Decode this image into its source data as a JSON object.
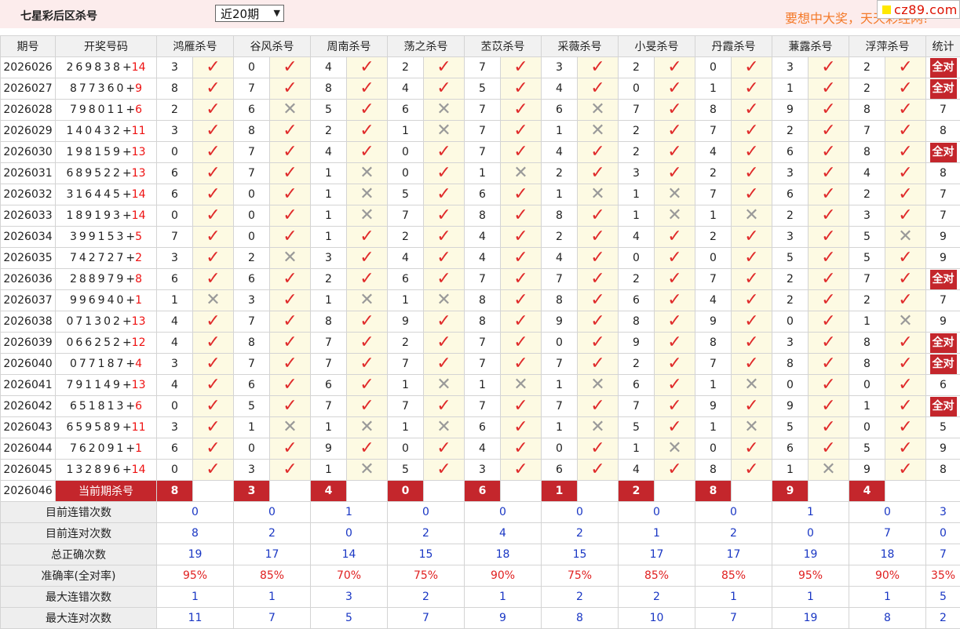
{
  "header": {
    "title": "七星彩后区杀号",
    "period_select": "近20期",
    "slogan": "要想中大奖，天天彩经网!",
    "badge": "cz89.com"
  },
  "columns": {
    "period": "期号",
    "draw": "开奖号码",
    "experts": [
      "鸿雁杀号",
      "谷风杀号",
      "周南杀号",
      "荡之杀号",
      "苤苡杀号",
      "采薇杀号",
      "小旻杀号",
      "丹霞杀号",
      "蒹露杀号",
      "浮萍杀号"
    ],
    "stats": "统计"
  },
  "rows": [
    {
      "period": "2026026",
      "front": "269838",
      "back": "14",
      "kills": [
        3,
        0,
        4,
        2,
        7,
        3,
        2,
        0,
        3,
        2
      ],
      "hits": [
        1,
        1,
        1,
        1,
        1,
        1,
        1,
        1,
        1,
        1
      ],
      "stat": "全对"
    },
    {
      "period": "2026027",
      "front": "877360",
      "back": "9",
      "kills": [
        8,
        7,
        8,
        4,
        5,
        4,
        0,
        1,
        1,
        2
      ],
      "hits": [
        1,
        1,
        1,
        1,
        1,
        1,
        1,
        1,
        1,
        1
      ],
      "stat": "全对"
    },
    {
      "period": "2026028",
      "front": "798011",
      "back": "6",
      "kills": [
        2,
        6,
        5,
        6,
        7,
        6,
        7,
        8,
        9,
        8
      ],
      "hits": [
        1,
        0,
        1,
        0,
        1,
        0,
        1,
        1,
        1,
        1
      ],
      "stat": "7"
    },
    {
      "period": "2026029",
      "front": "140432",
      "back": "11",
      "kills": [
        3,
        8,
        2,
        1,
        7,
        1,
        2,
        7,
        2,
        7
      ],
      "hits": [
        1,
        1,
        1,
        0,
        1,
        0,
        1,
        1,
        1,
        1
      ],
      "stat": "8"
    },
    {
      "period": "2026030",
      "front": "198159",
      "back": "13",
      "kills": [
        0,
        7,
        4,
        0,
        7,
        4,
        2,
        4,
        6,
        8
      ],
      "hits": [
        1,
        1,
        1,
        1,
        1,
        1,
        1,
        1,
        1,
        1
      ],
      "stat": "全对"
    },
    {
      "period": "2026031",
      "front": "689522",
      "back": "13",
      "kills": [
        6,
        7,
        1,
        0,
        1,
        2,
        3,
        2,
        3,
        4
      ],
      "hits": [
        1,
        1,
        0,
        1,
        0,
        1,
        1,
        1,
        1,
        1
      ],
      "stat": "8"
    },
    {
      "period": "2026032",
      "front": "316445",
      "back": "14",
      "kills": [
        6,
        0,
        1,
        5,
        6,
        1,
        1,
        7,
        6,
        2
      ],
      "hits": [
        1,
        1,
        0,
        1,
        1,
        0,
        0,
        1,
        1,
        1
      ],
      "stat": "7"
    },
    {
      "period": "2026033",
      "front": "189193",
      "back": "14",
      "kills": [
        0,
        0,
        1,
        7,
        8,
        8,
        1,
        1,
        2,
        3
      ],
      "hits": [
        1,
        1,
        0,
        1,
        1,
        1,
        0,
        0,
        1,
        1
      ],
      "stat": "7"
    },
    {
      "period": "2026034",
      "front": "399153",
      "back": "5",
      "kills": [
        7,
        0,
        1,
        2,
        4,
        2,
        4,
        2,
        3,
        5
      ],
      "hits": [
        1,
        1,
        1,
        1,
        1,
        1,
        1,
        1,
        1,
        0
      ],
      "stat": "9"
    },
    {
      "period": "2026035",
      "front": "742727",
      "back": "2",
      "kills": [
        3,
        2,
        3,
        4,
        4,
        4,
        0,
        0,
        5,
        5
      ],
      "hits": [
        1,
        0,
        1,
        1,
        1,
        1,
        1,
        1,
        1,
        1
      ],
      "stat": "9"
    },
    {
      "period": "2026036",
      "front": "288979",
      "back": "8",
      "kills": [
        6,
        6,
        2,
        6,
        7,
        7,
        2,
        7,
        2,
        7
      ],
      "hits": [
        1,
        1,
        1,
        1,
        1,
        1,
        1,
        1,
        1,
        1
      ],
      "stat": "全对"
    },
    {
      "period": "2026037",
      "front": "996940",
      "back": "1",
      "kills": [
        1,
        3,
        1,
        1,
        8,
        8,
        6,
        4,
        2,
        2
      ],
      "hits": [
        0,
        1,
        0,
        0,
        1,
        1,
        1,
        1,
        1,
        1
      ],
      "stat": "7"
    },
    {
      "period": "2026038",
      "front": "071302",
      "back": "13",
      "kills": [
        4,
        7,
        8,
        9,
        8,
        9,
        8,
        9,
        0,
        1
      ],
      "hits": [
        1,
        1,
        1,
        1,
        1,
        1,
        1,
        1,
        1,
        0
      ],
      "stat": "9"
    },
    {
      "period": "2026039",
      "front": "066252",
      "back": "12",
      "kills": [
        4,
        8,
        7,
        2,
        7,
        0,
        9,
        8,
        3,
        8
      ],
      "hits": [
        1,
        1,
        1,
        1,
        1,
        1,
        1,
        1,
        1,
        1
      ],
      "stat": "全对"
    },
    {
      "period": "2026040",
      "front": "077187",
      "back": "4",
      "kills": [
        3,
        7,
        7,
        7,
        7,
        7,
        2,
        7,
        8,
        8
      ],
      "hits": [
        1,
        1,
        1,
        1,
        1,
        1,
        1,
        1,
        1,
        1
      ],
      "stat": "全对"
    },
    {
      "period": "2026041",
      "front": "791149",
      "back": "13",
      "kills": [
        4,
        6,
        6,
        1,
        1,
        1,
        6,
        1,
        0,
        0
      ],
      "hits": [
        1,
        1,
        1,
        0,
        0,
        0,
        1,
        0,
        1,
        1
      ],
      "stat": "6"
    },
    {
      "period": "2026042",
      "front": "651813",
      "back": "6",
      "kills": [
        0,
        5,
        7,
        7,
        7,
        7,
        7,
        9,
        9,
        1
      ],
      "hits": [
        1,
        1,
        1,
        1,
        1,
        1,
        1,
        1,
        1,
        1
      ],
      "stat": "全对"
    },
    {
      "period": "2026043",
      "front": "659589",
      "back": "11",
      "kills": [
        3,
        1,
        1,
        1,
        6,
        1,
        5,
        1,
        5,
        0
      ],
      "hits": [
        1,
        0,
        0,
        0,
        1,
        0,
        1,
        0,
        1,
        1
      ],
      "stat": "5"
    },
    {
      "period": "2026044",
      "front": "762091",
      "back": "1",
      "kills": [
        6,
        0,
        9,
        0,
        4,
        0,
        1,
        0,
        6,
        5
      ],
      "hits": [
        1,
        1,
        1,
        1,
        1,
        1,
        0,
        1,
        1,
        1
      ],
      "stat": "9"
    },
    {
      "period": "2026045",
      "front": "132896",
      "back": "14",
      "kills": [
        0,
        3,
        1,
        5,
        3,
        6,
        4,
        8,
        1,
        9
      ],
      "hits": [
        1,
        1,
        0,
        1,
        1,
        1,
        1,
        1,
        0,
        1
      ],
      "stat": "8"
    }
  ],
  "current": {
    "period": "2026046",
    "label": "当前期杀号",
    "kills": [
      8,
      3,
      4,
      0,
      6,
      1,
      2,
      8,
      9,
      4
    ]
  },
  "icons": {
    "hit": "check-icon",
    "miss": "cross-icon"
  },
  "colors": {
    "accent": "#c4262c",
    "check": "#e02b2b",
    "stat_blue": "#1a37c4",
    "stat_red": "#e02020"
  },
  "stats": [
    {
      "label": "目前连错次数",
      "values": [
        "0",
        "0",
        "1",
        "0",
        "0",
        "0",
        "0",
        "0",
        "1",
        "0"
      ],
      "total": "3",
      "red": false
    },
    {
      "label": "目前连对次数",
      "values": [
        "8",
        "2",
        "0",
        "2",
        "4",
        "2",
        "1",
        "2",
        "0",
        "7"
      ],
      "total": "0",
      "red": false
    },
    {
      "label": "总正确次数",
      "values": [
        "19",
        "17",
        "14",
        "15",
        "18",
        "15",
        "17",
        "17",
        "19",
        "18"
      ],
      "total": "7",
      "red": false
    },
    {
      "label": "准确率(全对率)",
      "values": [
        "95%",
        "85%",
        "70%",
        "75%",
        "90%",
        "75%",
        "85%",
        "85%",
        "95%",
        "90%"
      ],
      "total": "35%",
      "red": true
    },
    {
      "label": "最大连错次数",
      "values": [
        "1",
        "1",
        "3",
        "2",
        "1",
        "2",
        "2",
        "1",
        "1",
        "1"
      ],
      "total": "5",
      "red": false
    },
    {
      "label": "最大连对次数",
      "values": [
        "11",
        "7",
        "5",
        "7",
        "9",
        "8",
        "10",
        "7",
        "19",
        "8"
      ],
      "total": "2",
      "red": false
    }
  ]
}
